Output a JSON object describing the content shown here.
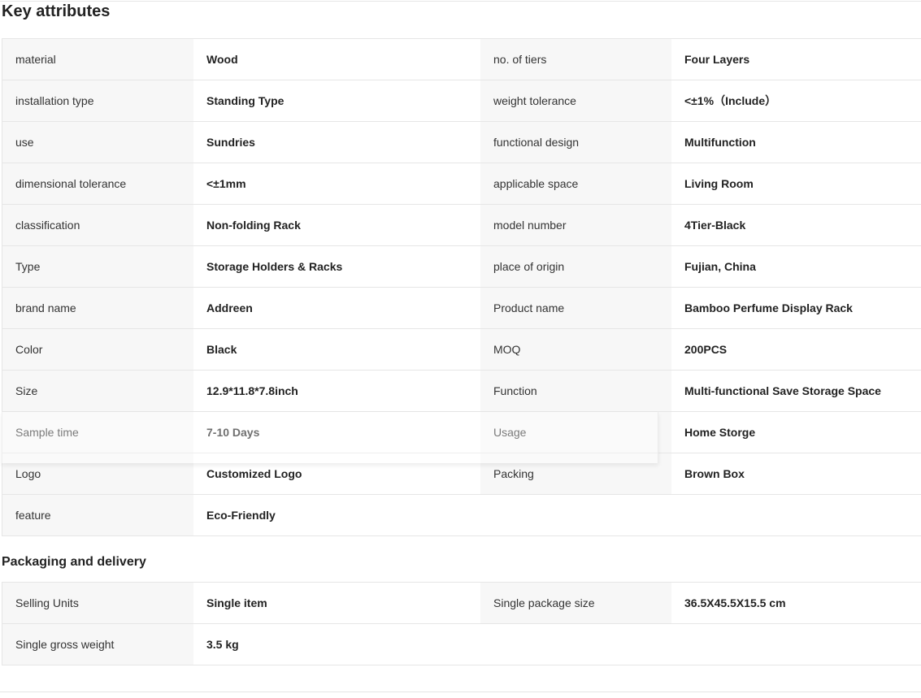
{
  "key_attributes": {
    "title": "Key attributes",
    "rows": [
      [
        {
          "name": "material",
          "value": "Wood"
        },
        {
          "name": "no. of tiers",
          "value": "Four Layers"
        }
      ],
      [
        {
          "name": "installation type",
          "value": "Standing Type"
        },
        {
          "name": "weight tolerance",
          "value": "<±1%（Include）"
        }
      ],
      [
        {
          "name": "use",
          "value": "Sundries"
        },
        {
          "name": "functional design",
          "value": "Multifunction"
        }
      ],
      [
        {
          "name": "dimensional tolerance",
          "value": "<±1mm"
        },
        {
          "name": "applicable space",
          "value": "Living Room"
        }
      ],
      [
        {
          "name": "classification",
          "value": "Non-folding Rack"
        },
        {
          "name": "model number",
          "value": "4Tier-Black"
        }
      ],
      [
        {
          "name": "Type",
          "value": "Storage Holders & Racks"
        },
        {
          "name": "place of origin",
          "value": "Fujian, China"
        }
      ],
      [
        {
          "name": "brand name",
          "value": "Addreen"
        },
        {
          "name": "Product name",
          "value": "Bamboo Perfume Display Rack"
        }
      ],
      [
        {
          "name": "Color",
          "value": "Black"
        },
        {
          "name": "MOQ",
          "value": "200PCS"
        }
      ],
      [
        {
          "name": "Size",
          "value": "12.9*11.8*7.8inch"
        },
        {
          "name": "Function",
          "value": "Multi-functional Save Storage Space"
        }
      ],
      [
        {
          "name": "Sample time",
          "value": "7-10 Days"
        },
        {
          "name": "Usage",
          "value": "Home Storge"
        }
      ],
      [
        {
          "name": "Logo",
          "value": "Customized Logo"
        },
        {
          "name": "Packing",
          "value": "Brown Box"
        }
      ],
      [
        {
          "name": "feature",
          "value": "Eco-Friendly"
        },
        {
          "name": "",
          "value": ""
        }
      ]
    ]
  },
  "packaging": {
    "title": "Packaging and delivery",
    "rows": [
      [
        {
          "name": "Selling Units",
          "value": "Single item"
        },
        {
          "name": "Single package size",
          "value": "36.5X45.5X15.5 cm"
        }
      ],
      [
        {
          "name": "Single gross weight",
          "value": "3.5 kg"
        },
        {
          "name": "",
          "value": ""
        }
      ]
    ]
  }
}
